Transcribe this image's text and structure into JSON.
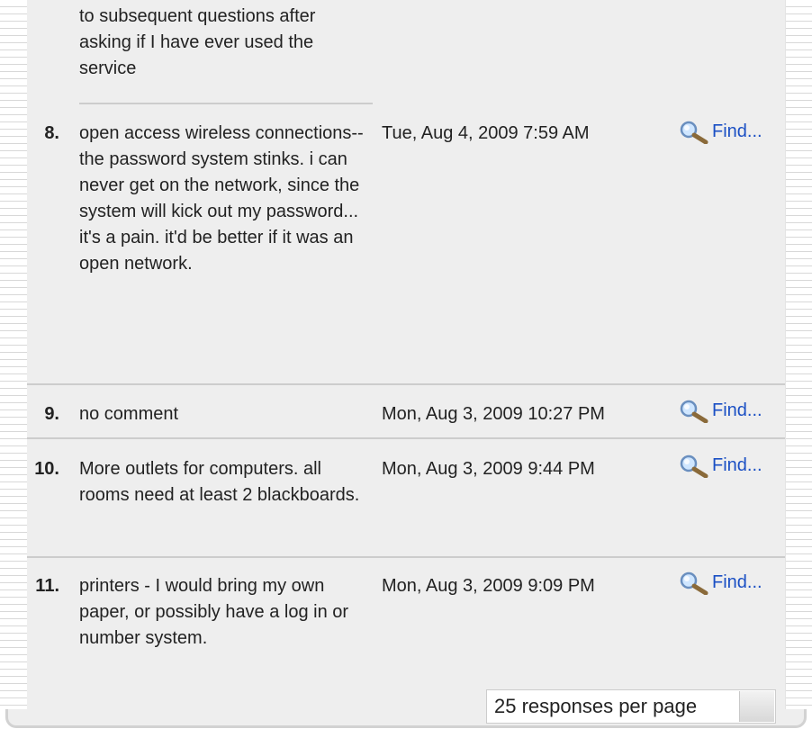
{
  "rows": [
    {
      "comment": "to subsequent questions after asking if I have ever used the service"
    },
    {
      "num": "8.",
      "comment": "open access wireless connections-- the password system stinks. i can never get on the network, since the system will kick out my password... it's a pain. it'd be better if it was an open network.",
      "date": "Tue, Aug 4, 2009 7:59 AM",
      "find": "Find..."
    },
    {
      "num": "9.",
      "comment": "no comment",
      "date": "Mon, Aug 3, 2009 10:27 PM",
      "find": "Find..."
    },
    {
      "num": "10.",
      "comment": "More outlets for computers. all rooms need at least 2 blackboards.",
      "date": "Mon, Aug 3, 2009 9:44 PM",
      "find": "Find..."
    },
    {
      "num": "11.",
      "comment": "printers - I would bring my own paper, or possibly have a log in or number system.",
      "date": "Mon, Aug 3, 2009 9:09 PM",
      "find": "Find..."
    }
  ],
  "pager": {
    "label": "25 responses per page"
  },
  "icons": {
    "find": "magnifier-icon"
  },
  "colors": {
    "panel": "#eeeeee",
    "link": "#1a4fc4",
    "separator": "#cccccc"
  }
}
